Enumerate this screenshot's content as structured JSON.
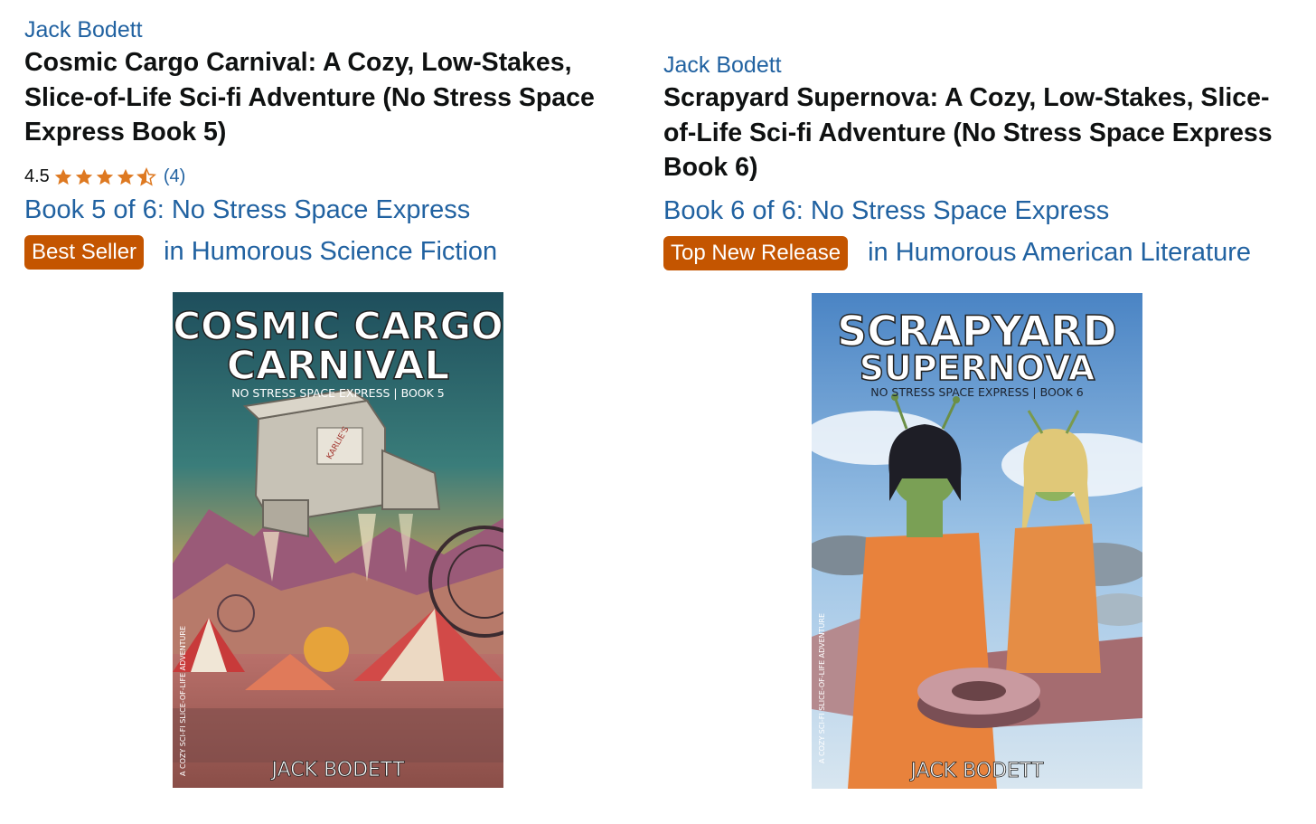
{
  "products": [
    {
      "author": "Jack Bodett",
      "title": "Cosmic Cargo Carnival: A Cozy, Low-Stakes, Slice-of-Life Sci-fi Adventure (No Stress Space Express Book 5)",
      "rating": {
        "value": "4.5",
        "stars": 4.5,
        "count": "(4)"
      },
      "series": "Book 5 of 6: No Stress Space Express",
      "badge": {
        "label": "Best Seller",
        "category": "in Humorous Science Fiction"
      },
      "cover": {
        "title_line1": "COSMIC CARGO",
        "title_line2": "CARNIVAL",
        "series_line": "NO STRESS SPACE EXPRESS | BOOK 5",
        "spine_text": "A COZY SCI-FI SLICE-OF-LIFE ADVENTURE",
        "author": "JACK BODETT",
        "ship_label": "KARLIE'S CARGO"
      }
    },
    {
      "author": "Jack Bodett",
      "title": "Scrapyard Supernova: A Cozy, Low-Stakes, Slice-of-Life Sci-fi Adventure (No Stress Space Express Book 6)",
      "series": "Book 6 of 6: No Stress Space Express",
      "badge": {
        "label": "Top New Release",
        "category": "in Humorous American Literature"
      },
      "cover": {
        "title_line1": "SCRAPYARD",
        "title_line2": "SUPERNOVA",
        "series_line": "NO STRESS SPACE EXPRESS | BOOK 6",
        "spine_text": "A COZY SCI-FI SLICE-OF-LIFE ADVENTURE",
        "author": "JACK BODETT"
      }
    }
  ],
  "colors": {
    "link": "#2162a1",
    "badge": "#c45500",
    "star": "#de7921",
    "text": "#0f1111"
  },
  "icons": {
    "star_full": "star-full-icon",
    "star_half": "star-half-icon"
  }
}
